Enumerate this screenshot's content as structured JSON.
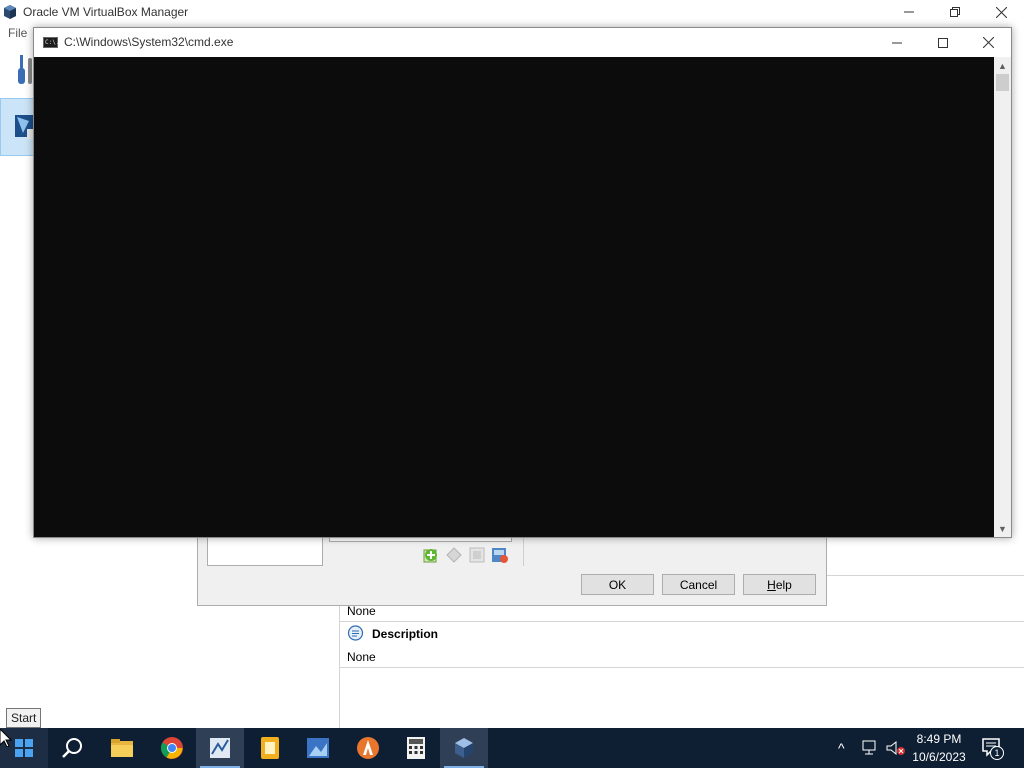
{
  "vbox": {
    "title": "Oracle VM VirtualBox Manager",
    "menu": {
      "file": "File"
    },
    "details": {
      "none_1": "None",
      "description_title": "Description",
      "none_2": "None"
    }
  },
  "dialog": {
    "buttons": {
      "ok": "OK",
      "cancel": "Cancel",
      "help_prefix": "H",
      "help_rest": "elp"
    },
    "tool_icons": [
      "add-icon",
      "remove-icon",
      "properties-icon",
      "settings-icon"
    ]
  },
  "cmd": {
    "title": "C:\\Windows\\System32\\cmd.exe",
    "icon_text": "C:\\."
  },
  "tooltip": {
    "start": "Start"
  },
  "taskbar": {
    "apps": [
      "search-icon",
      "file-explorer-icon",
      "chrome-icon",
      "app-icon",
      "notes-icon",
      "photos-icon",
      "app2-icon",
      "calculator-icon",
      "virtualbox-icon"
    ],
    "clock_time": "8:49 PM",
    "clock_date": "10/6/2023",
    "notifications_count": "1"
  },
  "colors": {
    "taskbar_bg": "#0f1f33",
    "console_bg": "#0c0c0c",
    "selection": "#cce4f7",
    "accent": "#7fb1e8"
  }
}
